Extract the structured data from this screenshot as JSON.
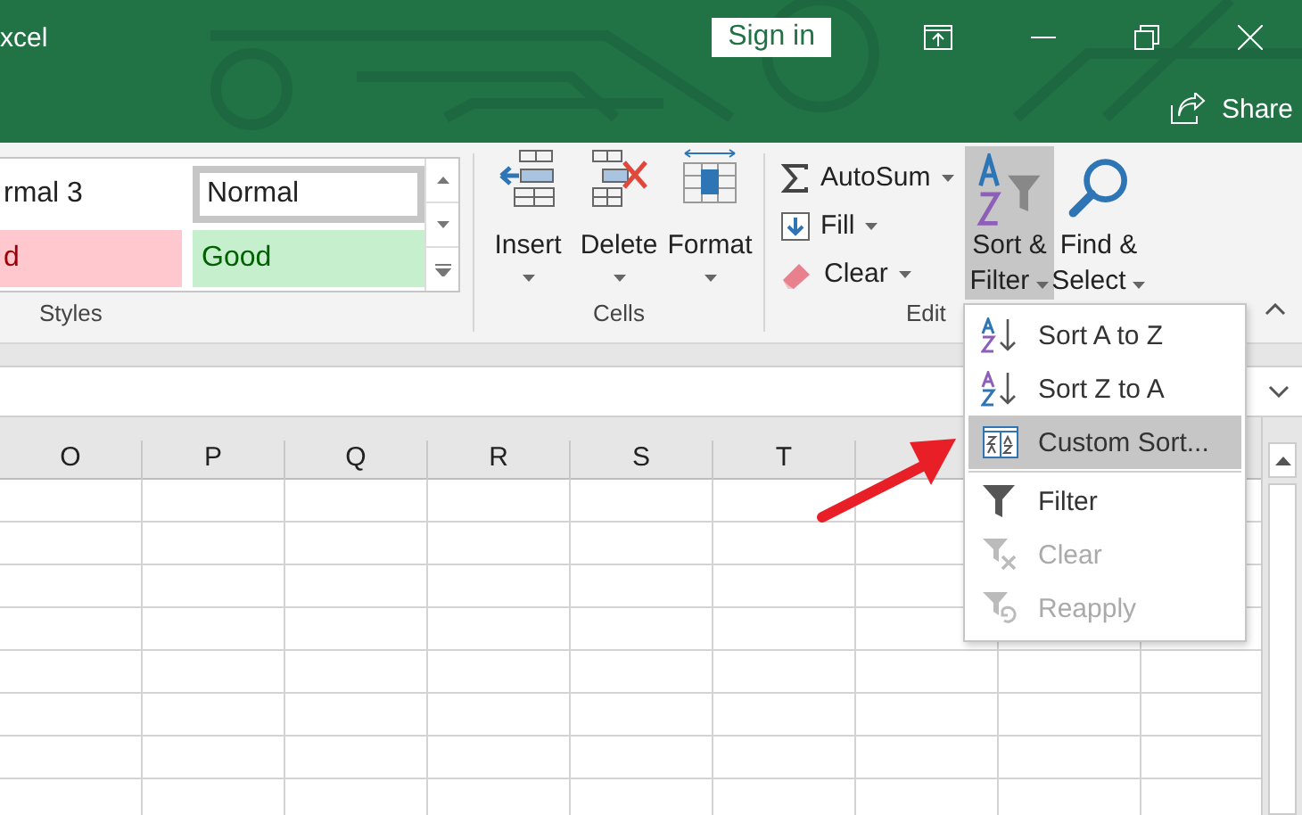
{
  "title_bar": {
    "title": "xcel",
    "sign_in": "Sign in",
    "share": "Share"
  },
  "ribbon": {
    "styles": {
      "label": "Styles",
      "cells": [
        {
          "text": "rmal 3",
          "kind": "plain",
          "selected": false
        },
        {
          "text": "Normal",
          "kind": "plain",
          "selected": true
        },
        {
          "text": "d",
          "kind": "bad",
          "selected": false
        },
        {
          "text": "Good",
          "kind": "good",
          "selected": false
        }
      ]
    },
    "cells": {
      "label": "Cells",
      "buttons": [
        {
          "label": "Insert",
          "kind": "insert"
        },
        {
          "label": "Delete",
          "kind": "delete"
        },
        {
          "label": "Format",
          "kind": "format"
        }
      ]
    },
    "editing": {
      "label": "Edit",
      "small_buttons": [
        {
          "label": "AutoSum",
          "kind": "sum"
        },
        {
          "label": "Fill",
          "kind": "fill"
        },
        {
          "label": "Clear",
          "kind": "eraser"
        }
      ],
      "big_buttons": [
        {
          "lines": [
            "Sort &",
            "Filter"
          ],
          "kind": "sort",
          "active": true
        },
        {
          "lines": [
            "Find &",
            "Select"
          ],
          "kind": "find",
          "active": false
        }
      ]
    }
  },
  "columns": [
    "O",
    "P",
    "Q",
    "R",
    "S",
    "T"
  ],
  "sort_menu": {
    "sections": [
      [
        {
          "label": "Sort A to Z",
          "kind": "az",
          "selected": false,
          "disabled": false
        },
        {
          "label": "Sort Z to A",
          "kind": "za",
          "selected": false,
          "disabled": false
        },
        {
          "label": "Custom Sort...",
          "kind": "custom",
          "selected": true,
          "disabled": false
        }
      ],
      [
        {
          "label": "Filter",
          "kind": "filter",
          "selected": false,
          "disabled": false
        },
        {
          "label": "Clear",
          "kind": "clear",
          "selected": false,
          "disabled": true
        },
        {
          "label": "Reapply",
          "kind": "reapply",
          "selected": false,
          "disabled": true
        }
      ]
    ]
  }
}
